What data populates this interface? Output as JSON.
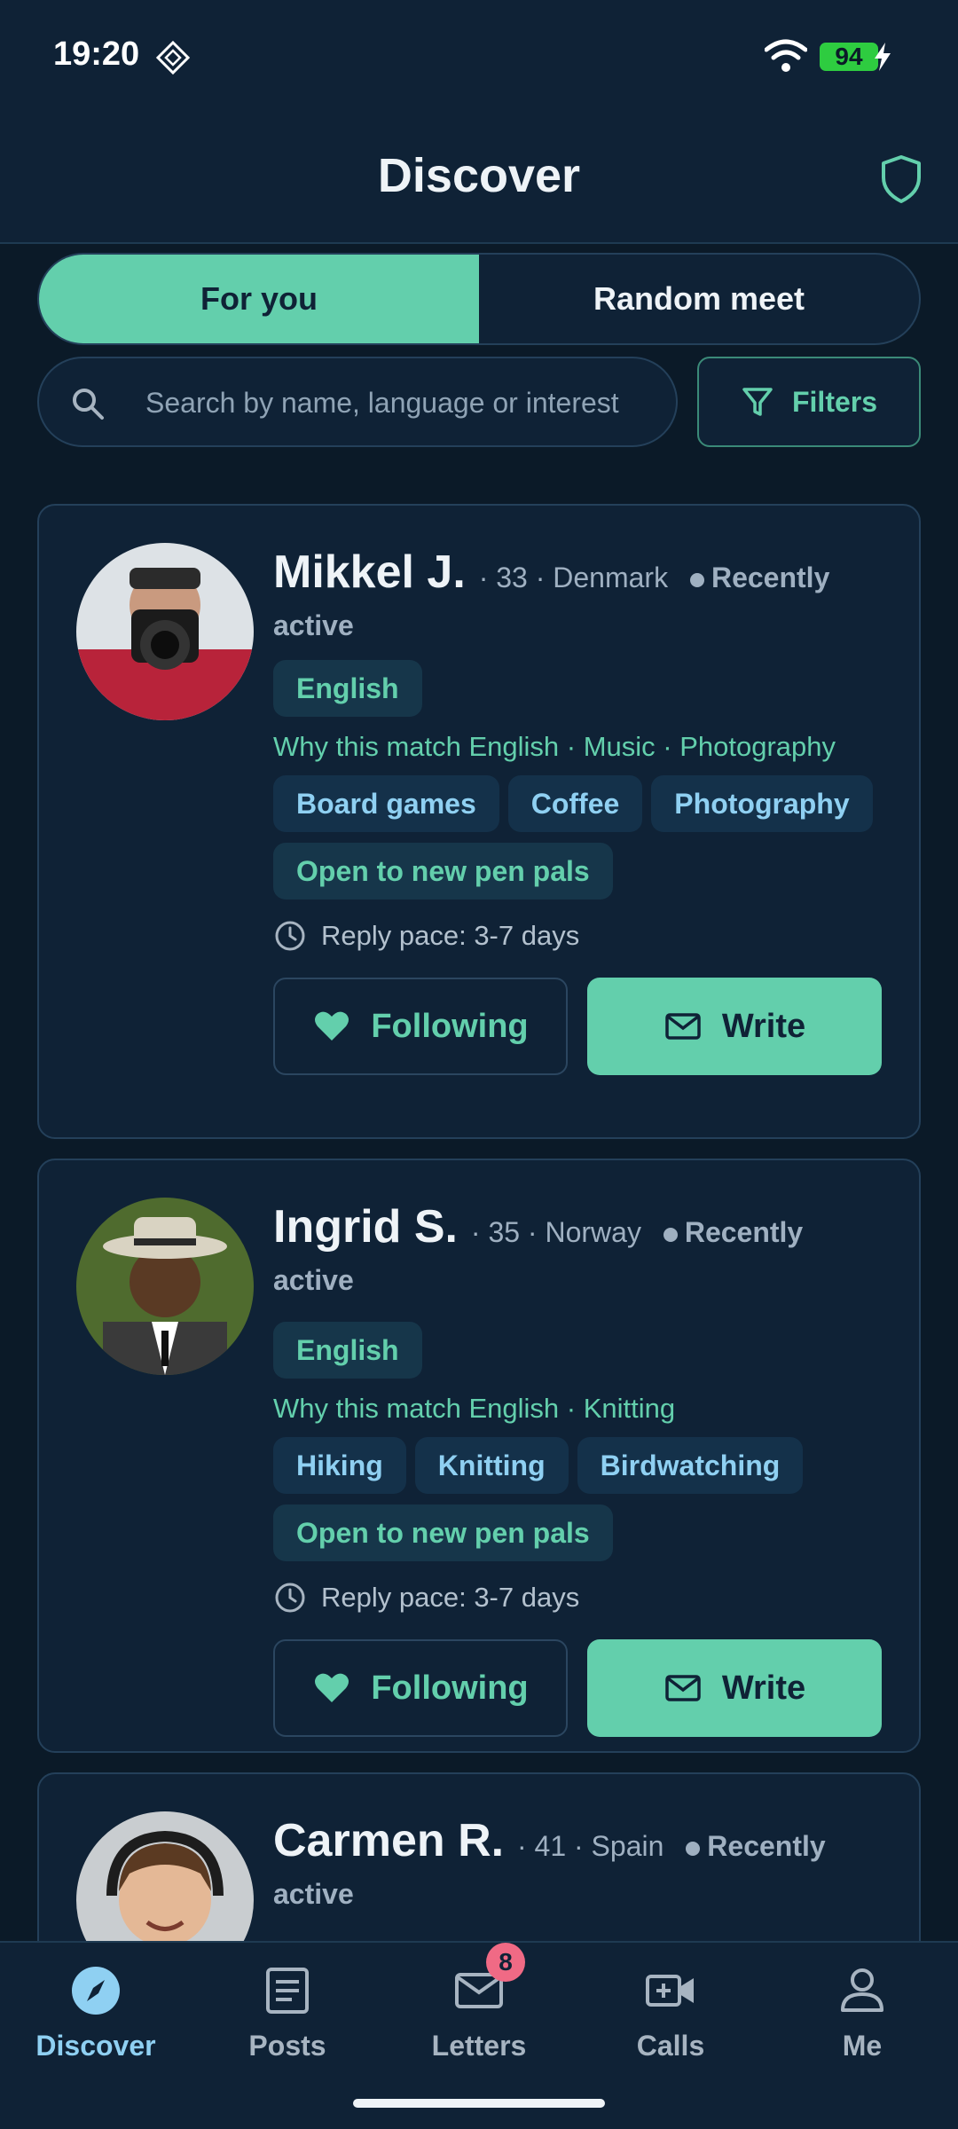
{
  "status": {
    "time": "19:20",
    "battery": "94"
  },
  "header": {
    "title": "Discover"
  },
  "tabs": [
    {
      "label": "For you",
      "active": true
    },
    {
      "label": "Random meet",
      "active": false
    }
  ],
  "search": {
    "placeholder": "Search by name, language or interest"
  },
  "filters": {
    "label": "Filters"
  },
  "profiles": [
    {
      "name": "Mikkel J.",
      "meta": "· 33 · Denmark",
      "status": "Recently active",
      "language_chip": "English",
      "why": "Why this match English · Music · Photography",
      "interests": [
        "Board games",
        "Coffee",
        "Photography"
      ],
      "open_chip": "Open to new pen pals",
      "reply_pace": "Reply pace: 3-7 days",
      "follow_label": "Following",
      "write_label": "Write"
    },
    {
      "name": "Ingrid S.",
      "meta": "· 35 · Norway",
      "status": "Recently active",
      "language_chip": "English",
      "why": "Why this match English · Knitting",
      "interests": [
        "Hiking",
        "Knitting",
        "Birdwatching"
      ],
      "open_chip": "Open to new pen pals",
      "reply_pace": "Reply pace: 3-7 days",
      "follow_label": "Following",
      "write_label": "Write"
    },
    {
      "name": "Carmen R.",
      "meta": "· 41 · Spain",
      "status": "Recently active"
    }
  ],
  "nav": [
    {
      "label": "Discover",
      "icon": "compass-icon",
      "active": true
    },
    {
      "label": "Posts",
      "icon": "posts-icon",
      "active": false
    },
    {
      "label": "Letters",
      "icon": "mail-icon",
      "active": false,
      "badge": "8"
    },
    {
      "label": "Calls",
      "icon": "video-icon",
      "active": false
    },
    {
      "label": "Me",
      "icon": "person-icon",
      "active": false
    }
  ],
  "colors": {
    "accent": "#63cfac",
    "background": "#0b1a28",
    "card": "#0f2236",
    "chip_blue": "#8fd0f2",
    "badge": "#f06a85"
  }
}
